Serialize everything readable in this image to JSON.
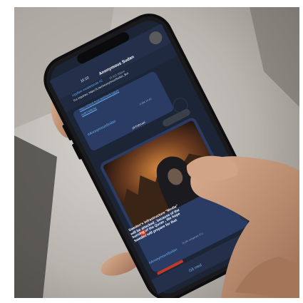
{
  "photo": {
    "subject": "hand-holding-smartphone",
    "colors": {
      "background": "#bfbcb8",
      "phone_frame": "#1a1a1d",
      "telegram_bg": "#1c2536",
      "message_bubble": "#2a3c63",
      "accent_red": "#c0392b",
      "skin": "#c89c7e"
    }
  },
  "phone": {
    "status_time": "16:10",
    "chat_title": "Anonymous Sudan",
    "chat_subtitle": "15 821 följare",
    "pinned_label": "Uppfäst meddelande #2",
    "pinned_text": "For inquiries: https://t.me/AnonymousSudan_Bot",
    "link_1": "https://check-host.net/check-report",
    "link_2": "/ed074d9c9e",
    "hashtag_1": "#AnonymousSudan",
    "time_1": "9 484 10:40",
    "date_badge": "18 Februari",
    "message_text": "Sweden's infrastructure \"Media\" will be attacked , because of the burning of the Quran , We hope Sweden will prepare for that",
    "msg_meta": "25,5K redigerad 10:1",
    "hashtag_2": "#AnonymousSudan",
    "join_button": "Gå med"
  }
}
